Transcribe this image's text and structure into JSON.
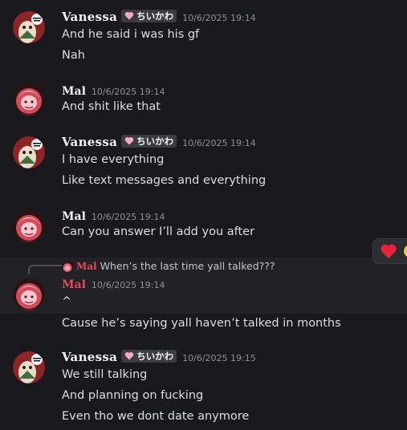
{
  "users": {
    "vanessa": {
      "name": "Vanessa",
      "tag": "ちいかわ",
      "tag_icon": "pink-heart-icon"
    },
    "mal": {
      "name": "Mal"
    }
  },
  "messages": [
    {
      "author": "Vanessa",
      "timestamp": "10/6/2025 19:14",
      "lines": [
        "And he said i was his gf",
        "Nah"
      ]
    },
    {
      "author": "Mal",
      "timestamp": "10/6/2025 19:14",
      "lines": [
        "And shit like that"
      ]
    },
    {
      "author": "Vanessa",
      "timestamp": "10/6/2025 19:14",
      "lines": [
        "I have everything",
        "Like text messages and everything"
      ]
    },
    {
      "author": "Mal",
      "timestamp": "10/6/2025 19:14",
      "lines": [
        "Can you answer I’ll add you after"
      ]
    },
    {
      "author": "Mal",
      "timestamp": "10/6/2025 19:14",
      "reply_to": {
        "author": "Mal",
        "text": "When’s the last time yall talked???"
      },
      "lines": [
        "^",
        "Cause he’s saying yall haven’t talked in months"
      ]
    },
    {
      "author": "Vanessa",
      "timestamp": "10/6/2025 19:15",
      "lines": [
        "We still talking",
        "And planning on fucking",
        "Even tho we dont date anymore"
      ]
    }
  ],
  "reaction_bar": {
    "icons": [
      "red-heart-icon",
      "emoji-partial-icon"
    ]
  }
}
